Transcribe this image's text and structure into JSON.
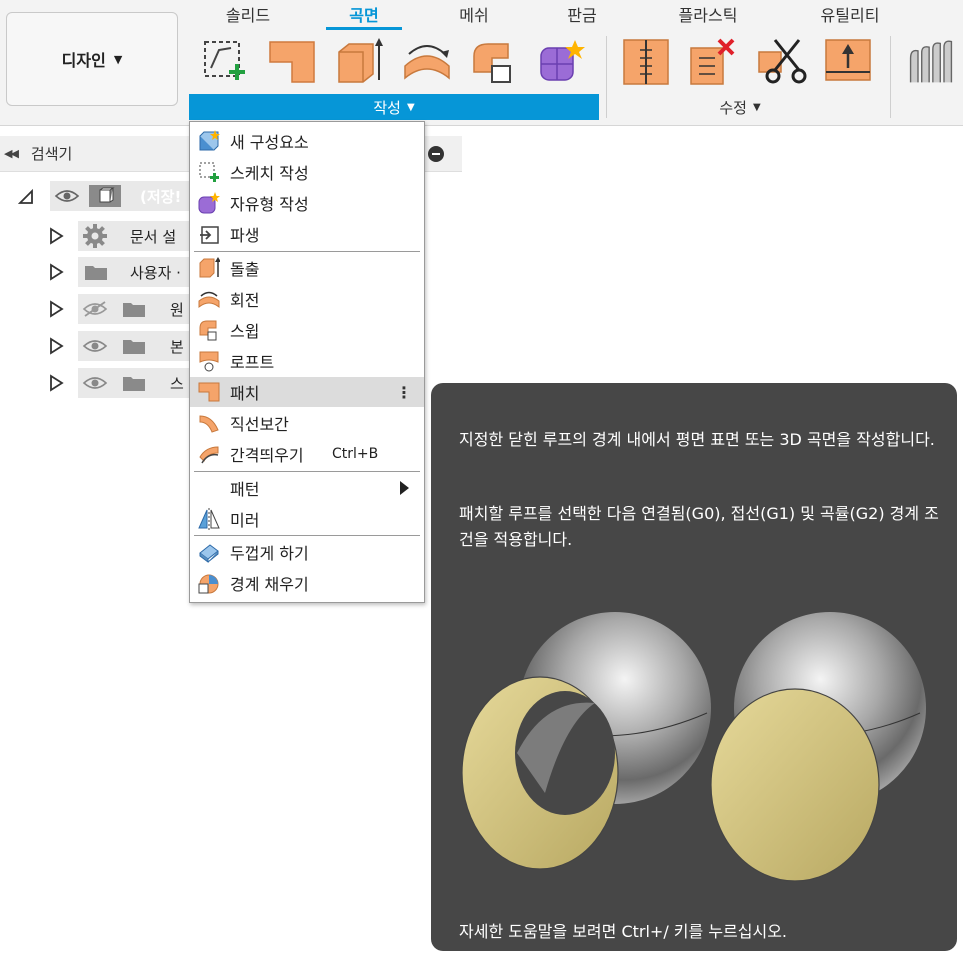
{
  "toolbar": {
    "design_label": "디자인",
    "tabs": [
      "솔리드",
      "곡면",
      "메쉬",
      "판금",
      "플라스틱",
      "유틸리티"
    ],
    "active_tab": "곡면",
    "create_group_label": "작성",
    "modify_group_label": "수정",
    "tools_create": [
      "sketch-create",
      "patch",
      "extrude",
      "revolve",
      "sweep",
      "form"
    ],
    "tools_modify": [
      "split-face",
      "delete",
      "trim",
      "offset"
    ]
  },
  "browser": {
    "title": "검색기",
    "root_label": "(저장!",
    "items": [
      {
        "label": "문서 설",
        "icon": "gear-icon",
        "visibility": "none"
      },
      {
        "label": "사용자 ·",
        "icon": "folder-icon",
        "visibility": "none"
      },
      {
        "label": "원",
        "icon": "folder-icon",
        "visibility": "hidden"
      },
      {
        "label": "본",
        "icon": "folder-icon",
        "visibility": "visible"
      },
      {
        "label": "스",
        "icon": "folder-icon",
        "visibility": "visible"
      }
    ]
  },
  "menu": {
    "items": [
      {
        "label": "새 구성요소",
        "icon": "new-component-icon"
      },
      {
        "label": "스케치 작성",
        "icon": "sketch-create-icon"
      },
      {
        "label": "자유형 작성",
        "icon": "form-create-icon"
      },
      {
        "label": "파생",
        "icon": "derive-icon"
      },
      {
        "label": "돌출",
        "icon": "extrude-icon"
      },
      {
        "label": "회전",
        "icon": "revolve-icon"
      },
      {
        "label": "스윕",
        "icon": "sweep-icon"
      },
      {
        "label": "로프트",
        "icon": "loft-icon"
      },
      {
        "label": "패치",
        "icon": "patch-icon",
        "highlighted": true
      },
      {
        "label": "직선보간",
        "icon": "ruled-icon"
      },
      {
        "label": "간격띄우기",
        "icon": "offset-icon",
        "shortcut": "Ctrl+B"
      },
      {
        "label": "패턴",
        "icon": "",
        "submenu": true
      },
      {
        "label": "미러",
        "icon": "mirror-icon"
      },
      {
        "label": "두껍게 하기",
        "icon": "thicken-icon"
      },
      {
        "label": "경계 채우기",
        "icon": "boundary-fill-icon"
      }
    ],
    "more_glyph": "⋮"
  },
  "tooltip": {
    "paragraph1": "지정한 닫힌 루프의 경계 내에서 평면 표면 또는 3D 곡면을 작성합니다.",
    "paragraph2": "패치할 루프를 선택한 다음 연결됨(G0), 접선(G1) 및 곡률(G2) 경계 조건을 적용합니다.",
    "footer": "자세한 도움말을 보려면 Ctrl+/ 키를 누르십시오."
  },
  "colors": {
    "accent": "#0696d7",
    "tool_orange": "#f5a46a",
    "tooltip_bg": "#474747",
    "patch_gold": "#cfc07a"
  }
}
